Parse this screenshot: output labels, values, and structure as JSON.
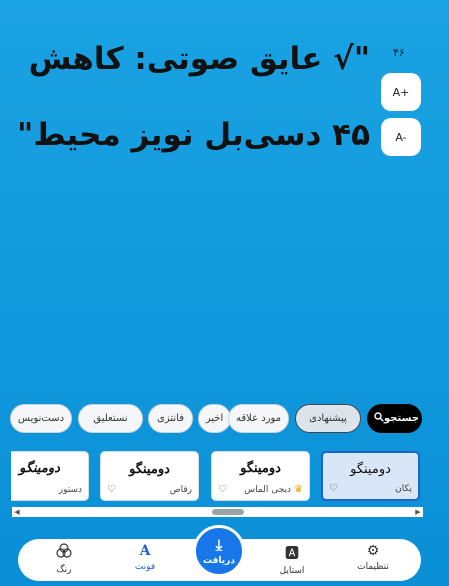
{
  "canvas": {
    "line1": "\"√ عایق صوتی: کاهش",
    "line2": "۴۵ دسی‌بل نویز محیط\""
  },
  "size_control": {
    "value": "۴۶",
    "increase_label": "A+",
    "decrease_label": "A-"
  },
  "filters": {
    "search_label": "جستجو",
    "chips": [
      "پیشنهادی",
      "مورد علاقه",
      "اخیر",
      "فانتزی",
      "نستعلیق",
      "دست‌نویس"
    ]
  },
  "fonts": [
    {
      "preview": "دومینگو",
      "name": "یکان",
      "premium": false
    },
    {
      "preview": "دومینگو",
      "name": "دیجی الماس",
      "premium": true
    },
    {
      "preview": "دومینگو",
      "name": "رقاص",
      "premium": false
    },
    {
      "preview": "دومینگو",
      "name": "دستور",
      "premium": false
    }
  ],
  "bottom_nav": {
    "settings": "تنظیمات",
    "style": "استایل",
    "download": "دریافت",
    "font": "فونت",
    "color": "رنگ"
  },
  "colors": {
    "background": "#0a8fd6",
    "accent": "#1f62c9",
    "download": "#1877e8"
  }
}
